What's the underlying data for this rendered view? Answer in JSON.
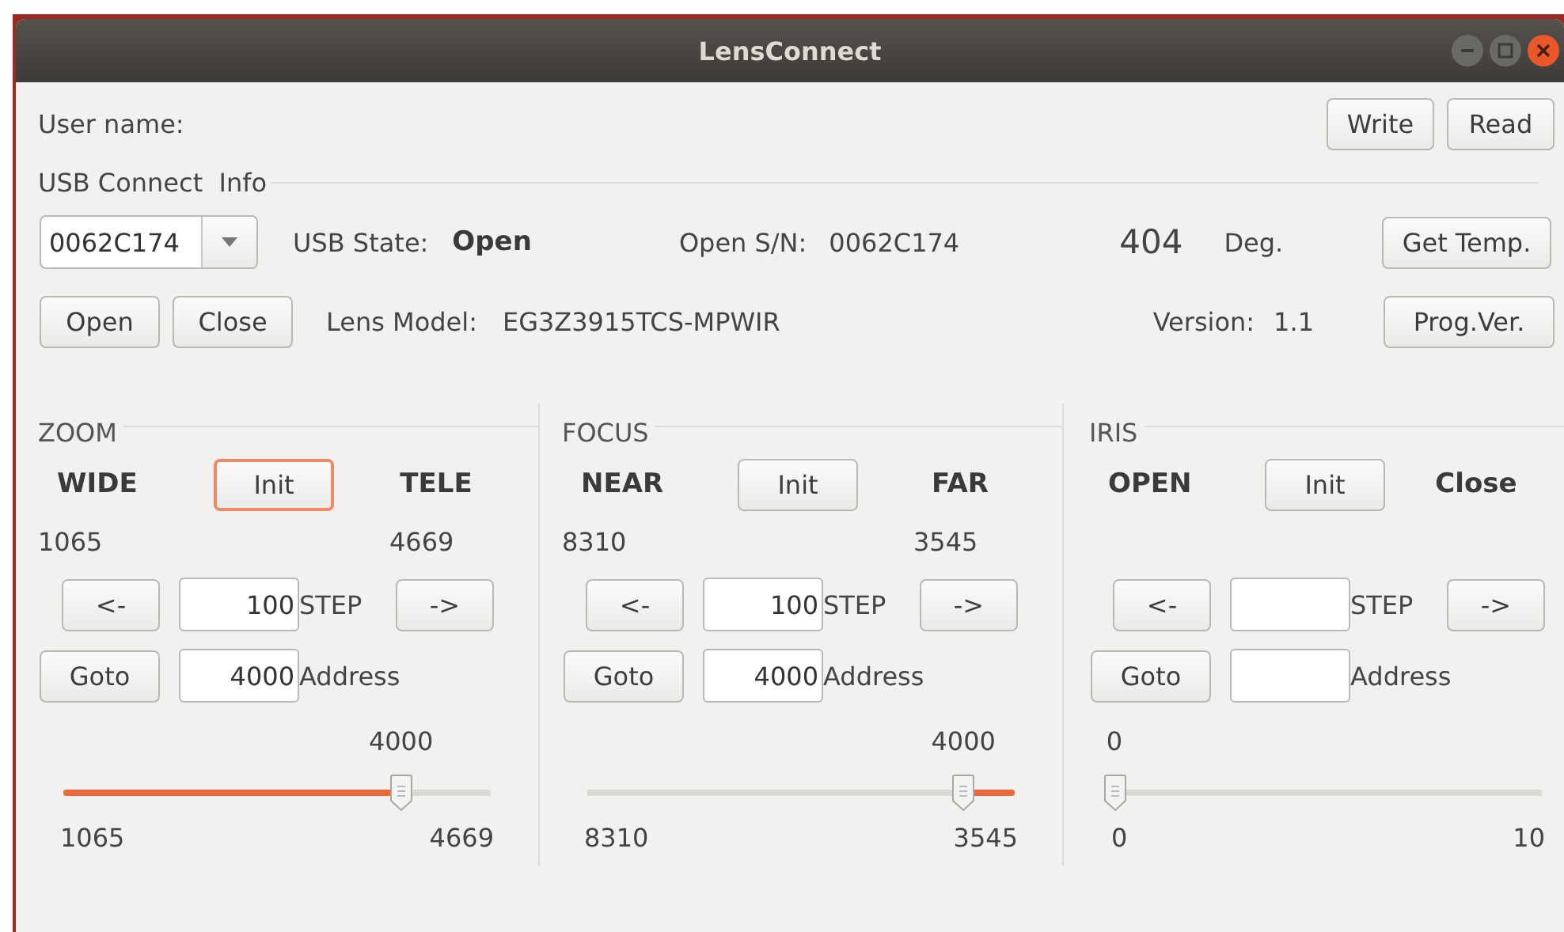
{
  "window": {
    "title": "LensConnect"
  },
  "user_name_label": "User name:",
  "top_buttons": [
    "Write",
    "Read"
  ],
  "usb_info": {
    "legend": "USB Connect  Info",
    "device": "0062C174",
    "usb_state_label": "USB State:",
    "usb_state": "Open",
    "open_sn_label": "Open S/N:",
    "open_sn": "0062C174",
    "temperature": "404",
    "temperature_unit": "Deg.",
    "get_temp_button": "Get Temp.",
    "open_button": "Open",
    "close_button": "Close",
    "lens_model_label": "Lens Model:",
    "lens_model": "EG3Z3915TCS-MPWIR",
    "version_label": "Version:",
    "version": "1.1",
    "prog_ver_button": "Prog.Ver."
  },
  "panels": [
    {
      "title": "ZOOM",
      "left_label": "WIDE",
      "init_button": "Init",
      "init_focused": true,
      "right_label": "TELE",
      "left_limit": "1065",
      "right_limit": "4669",
      "left_button": "<-",
      "step": "100",
      "step_label": "STEP",
      "right_button": "->",
      "goto_button": "Goto",
      "address": "4000",
      "address_label": "Address",
      "slider_value": "4000",
      "slider": {
        "level": 0.79,
        "inverted": false
      },
      "slider_min": "1065",
      "slider_max": "4669"
    },
    {
      "title": "FOCUS",
      "left_label": "NEAR",
      "init_button": "Init",
      "init_focused": false,
      "right_label": "FAR",
      "left_limit": "8310",
      "right_limit": "3545",
      "left_button": "<-",
      "step": "100",
      "step_label": "STEP",
      "right_button": "->",
      "goto_button": "Goto",
      "address": "4000",
      "address_label": "Address",
      "slider_value": "4000",
      "slider": {
        "level": 0.88,
        "inverted": true
      },
      "slider_min": "8310",
      "slider_max": "3545"
    },
    {
      "title": "IRIS",
      "left_label": "OPEN",
      "init_button": "Init",
      "init_focused": false,
      "right_label": "Close",
      "left_button": "<-",
      "step_label": "STEP",
      "right_button": "->",
      "goto_button": "Goto",
      "address_label": "Address",
      "slider_value": "0",
      "slider": {
        "level": 0
      },
      "slider_min": "0",
      "slider_max": "10"
    }
  ]
}
